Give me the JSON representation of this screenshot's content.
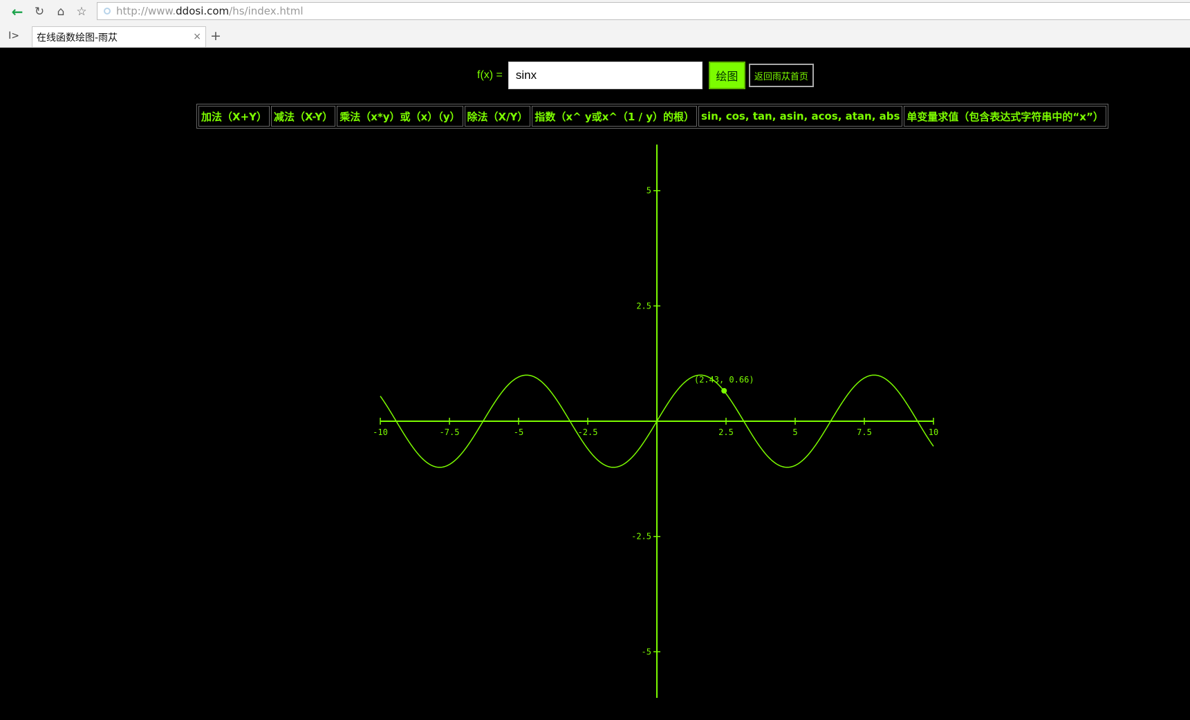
{
  "browser": {
    "url_prefix": "http://www.",
    "url_domain": "ddosi.com",
    "url_path": "/hs/index.html",
    "tab_title": "在线函数绘图-雨苁",
    "tab_close": "×",
    "new_tab": "+",
    "sidebar_toggle": "I>",
    "back": "←",
    "reload": "↻",
    "home": "⌂",
    "star": "☆"
  },
  "form": {
    "fx_label": "f(x) =",
    "expression": "sinx",
    "plot_button": "绘图",
    "home_button": "返回雨苁首页"
  },
  "help": [
    "加法（X+Y）",
    "减法（X-Y）",
    "乘法（x*y）或（x）（y）",
    "除法（X/Y）",
    "指数（x^ y或x^（1 / y）的根）",
    "sin, cos, tan, asin, acos, atan, abs",
    "单变量求值（包含表达式字符串中的“x”）"
  ],
  "colors": {
    "accent": "#7cfc00",
    "background": "#000000"
  },
  "chart_data": {
    "type": "line",
    "function": "sin(x)",
    "xlim": [
      -10,
      10
    ],
    "ylim": [
      -6,
      6
    ],
    "x_ticks": [
      -10,
      -7.5,
      -5,
      -2.5,
      2.5,
      5,
      7.5,
      10
    ],
    "x_tick_labels": [
      "-10",
      "-7.5",
      "-5",
      "-2.5",
      "2.5",
      "5",
      "7.5",
      "10"
    ],
    "y_ticks": [
      5,
      2.5,
      -2.5,
      -5
    ],
    "y_tick_labels": [
      "5",
      "2.5",
      "-2.5",
      "-5"
    ],
    "highlight_point": {
      "x": 2.43,
      "y": 0.66,
      "label": "(2.43, 0.66)"
    },
    "grid": false
  }
}
